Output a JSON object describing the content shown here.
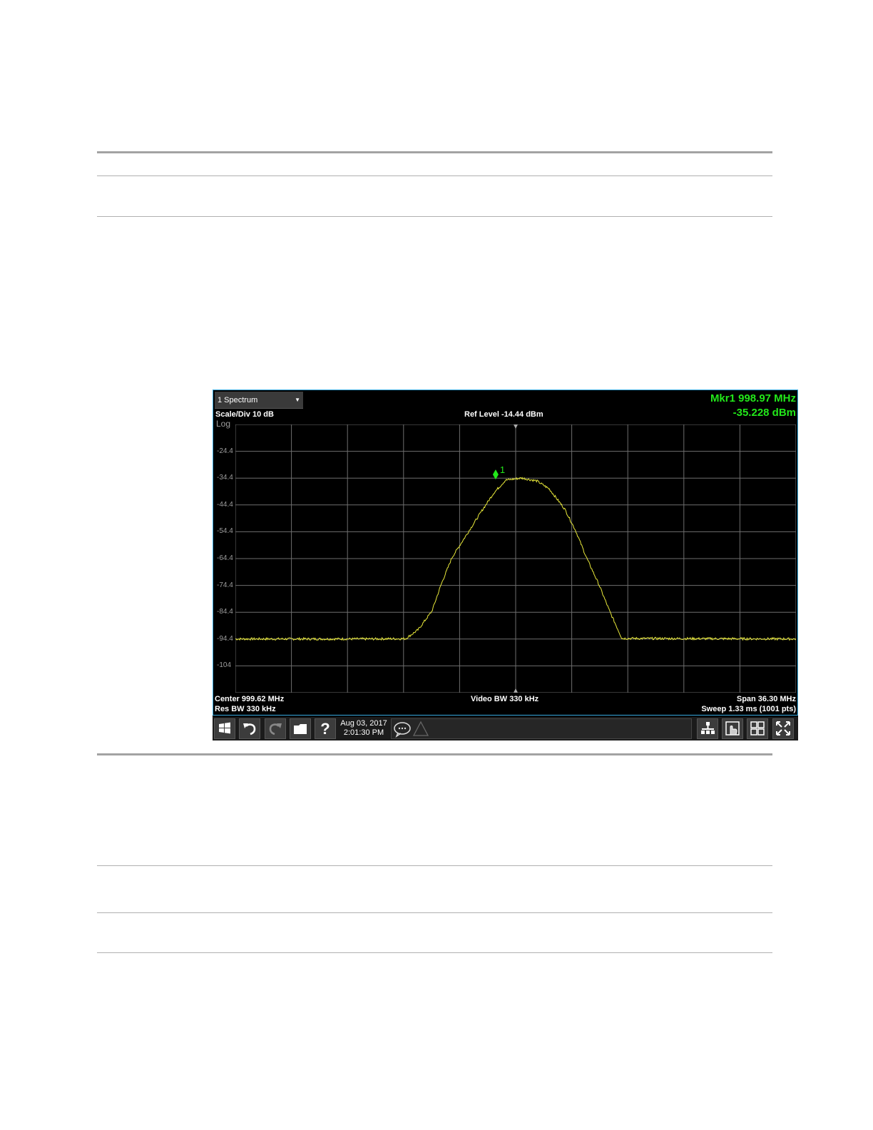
{
  "window": {
    "tab_label": "1 Spectrum"
  },
  "annotations": {
    "scale_div": "Scale/Div 10 dB",
    "ref_level": "Ref Level -14.44 dBm",
    "scale_type": "Log",
    "marker_freq": "Mkr1  998.97 MHz",
    "marker_amp": "-35.228 dBm",
    "marker_label": "1",
    "center_freq": "Center 999.62 MHz",
    "res_bw": "Res BW 330 kHz",
    "video_bw": "Video BW 330 kHz",
    "span": "Span 36.30 MHz",
    "sweep": "Sweep 1.33 ms (1001 pts)"
  },
  "y_axis_labels": [
    "-24.4",
    "-34.4",
    "-44.4",
    "-54.4",
    "-64.4",
    "-74.4",
    "-84.4",
    "-94.4",
    "-104"
  ],
  "taskbar": {
    "date": "Aug 03, 2017",
    "time": "2:01:30 PM",
    "icons": [
      "windows-icon",
      "undo-icon",
      "redo-icon",
      "folder-icon",
      "help-icon",
      "message-icon",
      "warning-icon",
      "network-icon",
      "touch-icon",
      "layout-icon",
      "fullscreen-icon"
    ]
  },
  "colors": {
    "trace": "#e8e83a",
    "marker": "#22e81a",
    "grid": "#6e6e6e",
    "border": "#38a9df"
  },
  "chart_data": {
    "type": "line",
    "title": "",
    "xlabel": "",
    "ylabel": "",
    "x_unit": "MHz",
    "y_unit": "dBm",
    "xlim": [
      981.47,
      1017.77
    ],
    "ylim": [
      -114.44,
      -14.44
    ],
    "grid": true,
    "series": [
      {
        "x": [
          981.47,
          990.0,
          992.5,
          993.3,
          994.2,
          994.8,
          995.5,
          996.5,
          997.5,
          998.2,
          998.97,
          1000.0,
          1001.0,
          1001.8,
          1002.8,
          1003.5,
          1004.2,
          1005.0,
          1005.7,
          1006.5,
          1017.77
        ],
        "y": [
          -94.4,
          -94.4,
          -94.3,
          -91.0,
          -84.0,
          -74.0,
          -64.0,
          -55.0,
          -46.0,
          -40.0,
          -35.2,
          -34.4,
          -35.5,
          -38.5,
          -46.0,
          -54.0,
          -64.0,
          -74.0,
          -84.0,
          -94.2,
          -94.4
        ]
      }
    ],
    "markers": [
      {
        "label": "1",
        "x": 998.97,
        "y": -35.228
      }
    ]
  }
}
